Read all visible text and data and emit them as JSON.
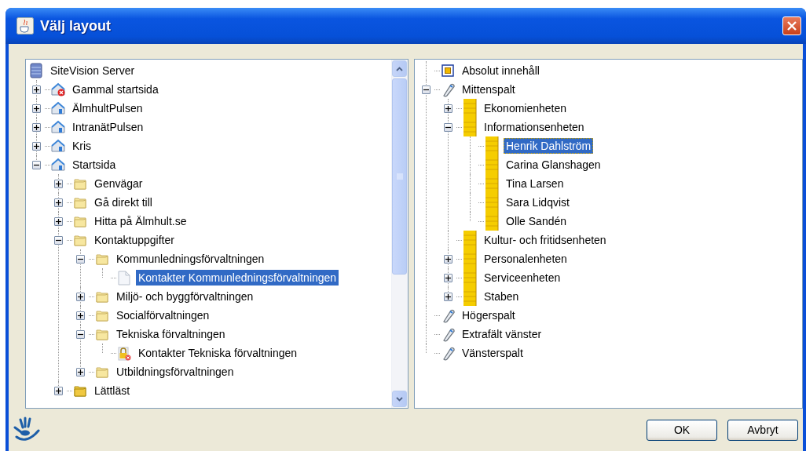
{
  "window": {
    "title": "Välj layout"
  },
  "site_tree": {
    "root": {
      "label": "SiteVision Server",
      "kind": "server",
      "selected": false,
      "children": [
        {
          "label": "Gammal startsida",
          "kind": "site-error",
          "expanded": false,
          "selected": false
        },
        {
          "label": "ÄlmhultPulsen",
          "kind": "site",
          "expanded": false,
          "selected": false
        },
        {
          "label": "IntranätPulsen",
          "kind": "site",
          "expanded": false,
          "selected": false
        },
        {
          "label": "Kris",
          "kind": "site",
          "expanded": false,
          "selected": false
        },
        {
          "label": "Startsida",
          "kind": "site",
          "expanded": true,
          "selected": false,
          "children": [
            {
              "label": "Genvägar",
              "kind": "folder",
              "expanded": false,
              "selected": false
            },
            {
              "label": "Gå direkt till",
              "kind": "folder",
              "expanded": false,
              "selected": false
            },
            {
              "label": "Hitta på Älmhult.se",
              "kind": "folder",
              "expanded": false,
              "selected": false
            },
            {
              "label": "Kontaktuppgifter",
              "kind": "folder",
              "expanded": true,
              "selected": false,
              "children": [
                {
                  "label": "Kommunledningsförvaltningen",
                  "kind": "folder",
                  "expanded": true,
                  "selected": false,
                  "children": [
                    {
                      "label": "Kontakter Kommunledningsförvaltningen",
                      "kind": "page",
                      "selected": true
                    }
                  ]
                },
                {
                  "label": "Miljö- och byggförvaltningen",
                  "kind": "folder",
                  "expanded": false,
                  "selected": false
                },
                {
                  "label": "Socialförvaltningen",
                  "kind": "folder",
                  "expanded": false,
                  "selected": false
                },
                {
                  "label": "Tekniska förvaltningen",
                  "kind": "folder",
                  "expanded": true,
                  "selected": false,
                  "children": [
                    {
                      "label": "Kontakter Tekniska förvaltningen",
                      "kind": "page-locked",
                      "selected": false
                    }
                  ]
                },
                {
                  "label": "Utbildningsförvaltningen",
                  "kind": "folder",
                  "expanded": false,
                  "selected": false
                }
              ]
            },
            {
              "label": "Lättläst",
              "kind": "folder-dark",
              "expanded": false,
              "selected": false
            }
          ]
        }
      ]
    }
  },
  "layout_tree": {
    "items": [
      {
        "label": "Absolut innehåll",
        "kind": "absolute",
        "selected": false
      },
      {
        "label": "Mittenspalt",
        "kind": "clip",
        "expanded": true,
        "selected": false,
        "children": [
          {
            "label": "Ekonomienheten",
            "kind": "bar",
            "expanded": false,
            "selected": false
          },
          {
            "label": "Informationsenheten",
            "kind": "bar",
            "expanded": true,
            "selected": false,
            "children": [
              {
                "label": "Henrik Dahlström",
                "kind": "bar",
                "selected": true
              },
              {
                "label": "Carina Glanshagen",
                "kind": "bar",
                "selected": false
              },
              {
                "label": "Tina Larsen",
                "kind": "bar",
                "selected": false
              },
              {
                "label": "Sara Lidqvist",
                "kind": "bar",
                "selected": false
              },
              {
                "label": "Olle Sandén",
                "kind": "bar",
                "selected": false
              }
            ]
          },
          {
            "label": "Kultur- och fritidsenheten",
            "kind": "bar",
            "selected": false
          },
          {
            "label": "Personalenheten",
            "kind": "bar",
            "expanded": false,
            "selected": false
          },
          {
            "label": "Serviceenheten",
            "kind": "bar",
            "expanded": false,
            "selected": false
          },
          {
            "label": "Staben",
            "kind": "bar",
            "expanded": false,
            "selected": false
          }
        ]
      },
      {
        "label": "Högerspalt",
        "kind": "clip",
        "selected": false
      },
      {
        "label": "Extrafält vänster",
        "kind": "clip",
        "selected": false
      },
      {
        "label": "Vänsterspalt",
        "kind": "clip",
        "selected": false
      }
    ]
  },
  "buttons": [
    "OK",
    "Avbryt"
  ]
}
